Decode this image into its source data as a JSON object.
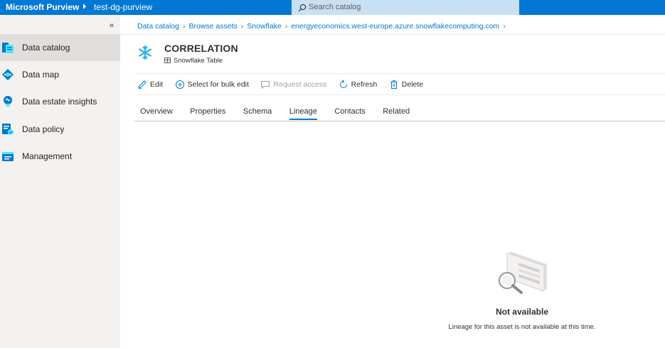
{
  "topbar": {
    "brand": "Microsoft Purview",
    "account": "test-dg-purview",
    "search_placeholder": "Search catalog"
  },
  "sidebar": {
    "collapse_glyph": "«",
    "items": [
      {
        "label": "Data catalog",
        "icon": "data-catalog-icon",
        "active": true
      },
      {
        "label": "Data map",
        "icon": "data-map-icon"
      },
      {
        "label": "Data estate insights",
        "icon": "insights-icon"
      },
      {
        "label": "Data policy",
        "icon": "data-policy-icon"
      },
      {
        "label": "Management",
        "icon": "management-icon"
      }
    ]
  },
  "breadcrumb": [
    "Data catalog",
    "Browse assets",
    "Snowflake",
    "energyeconomics.west-europe.azure.snowflakecomputing.com"
  ],
  "asset": {
    "title": "CORRELATION",
    "type": "Snowflake Table",
    "icon": "snowflake-icon",
    "icon_color": "#29b5e8"
  },
  "commands": [
    {
      "label": "Edit",
      "icon": "edit-icon"
    },
    {
      "label": "Select for bulk edit",
      "icon": "add-circle-icon"
    },
    {
      "label": "Request access",
      "icon": "comment-icon",
      "disabled": true
    },
    {
      "label": "Refresh",
      "icon": "refresh-icon"
    },
    {
      "label": "Delete",
      "icon": "delete-icon"
    }
  ],
  "tabs": [
    "Overview",
    "Properties",
    "Schema",
    "Lineage",
    "Contacts",
    "Related"
  ],
  "active_tab": "Lineage",
  "lineage": {
    "empty_title": "Not available",
    "empty_message": "Lineage for this asset is not available at this time."
  },
  "colors": {
    "topbar": "#0078d4",
    "accent": "#0078d4",
    "sidebar_bg": "#f3f2f1",
    "sidebar_active": "#e1dfdd"
  }
}
